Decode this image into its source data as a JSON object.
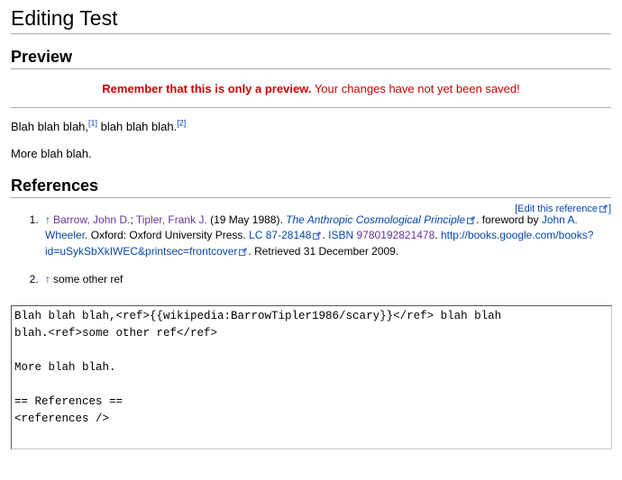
{
  "page": {
    "title": "Editing Test"
  },
  "preview": {
    "heading": "Preview",
    "warning_bold": "Remember that this is only a preview.",
    "warning_rest": "Your changes have not yet been saved!",
    "warning_color": "#cc0000"
  },
  "content": {
    "paragraph1_part1": "Blah blah blah,",
    "paragraph1_ref1": "[1]",
    "paragraph1_part2": " blah blah blah.",
    "paragraph1_ref2": "[2]",
    "paragraph2": "More blah blah."
  },
  "references": {
    "heading": "References",
    "edit_link_open_bracket": "[",
    "edit_link_label": "Edit this reference",
    "edit_link_close_bracket": "]",
    "backlink_arrow": "↑",
    "items": [
      {
        "authors_1": "Barrow, John D.",
        "authors_sep": "; ",
        "authors_2": "Tipler, Frank J.",
        "date": " (19 May 1988). ",
        "title": "The Anthropic Cosmological Principle",
        "after_title": ". foreword by ",
        "foreword_author": "John A. Wheeler",
        "publisher": ". Oxford: Oxford University Press. ",
        "lc_label": "LC 87-28148",
        "isbn_sep": ". ",
        "isbn_label": "ISBN",
        "isbn_value": "9780192821478",
        "isbn_end": ". ",
        "url": "http://books.google.com/books?id=uSykSbXkIWEC&printsec=frontcover",
        "retrieved": ". Retrieved 31 December 2009."
      },
      {
        "text": "some other ref"
      }
    ]
  },
  "editor": {
    "wikitext": "Blah blah blah,<ref>{{wikipedia:BarrowTipler1986/scary}}</ref> blah blah\nblah.<ref>some other ref</ref>\n\nMore blah blah.\n\n== References ==\n<references />"
  },
  "colors": {
    "link": "#0645ad",
    "visited_link": "#663399",
    "rule": "#aaaaaa",
    "warning": "#cc0000"
  }
}
